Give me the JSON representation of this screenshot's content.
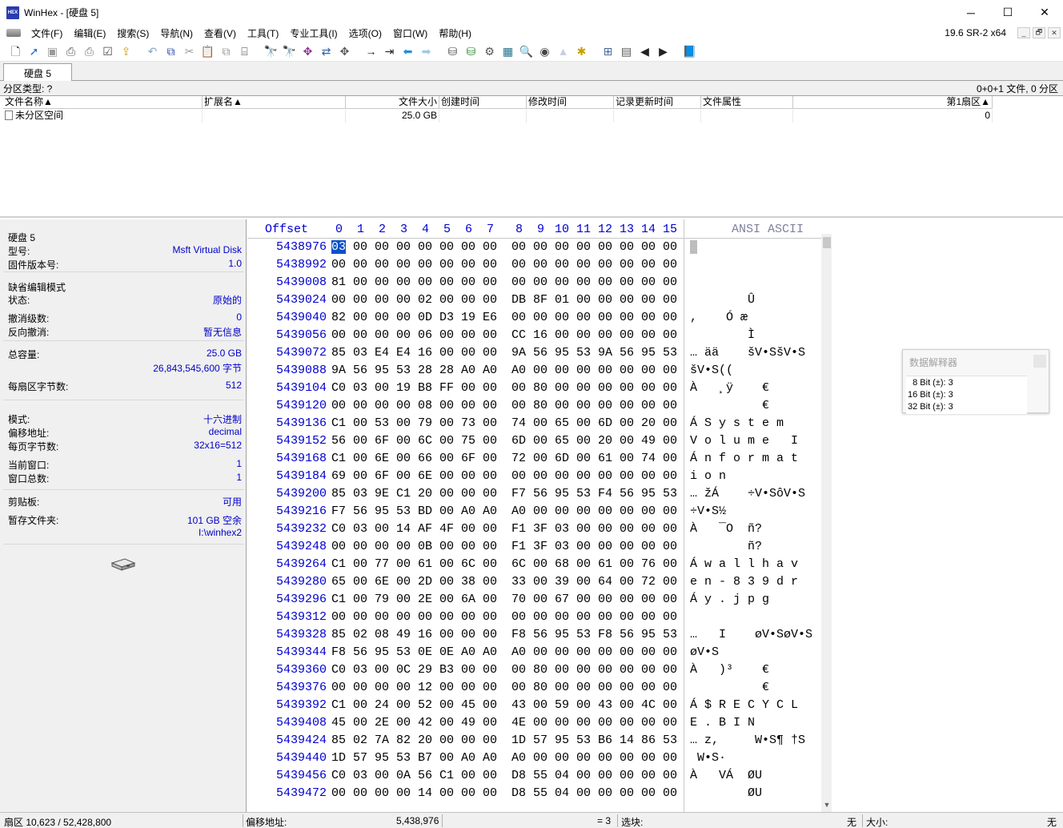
{
  "window": {
    "title": "WinHex - [硬盘 5]",
    "app_icon_text": "HEX",
    "controls": {
      "minimize": "─",
      "maximize": "☐",
      "close": "✕"
    }
  },
  "menu": {
    "items": [
      "文件(F)",
      "编辑(E)",
      "搜索(S)",
      "导航(N)",
      "查看(V)",
      "工具(T)",
      "专业工具(I)",
      "选项(O)",
      "窗口(W)",
      "帮助(H)"
    ],
    "version": "19.6 SR-2 x64",
    "mdi": {
      "minimize": "_",
      "restore": "🗗",
      "close": "✕"
    }
  },
  "toolbar": {
    "buttons": [
      {
        "name": "new-icon",
        "glyph": "🗋",
        "color": "#333333"
      },
      {
        "name": "open-icon",
        "glyph": "➚",
        "color": "#1e6fd9"
      },
      {
        "name": "save-icon",
        "glyph": "▣",
        "color": "#9a9a9a"
      },
      {
        "name": "print-icon",
        "glyph": "⎙",
        "color": "#555555"
      },
      {
        "name": "print-setup-icon",
        "glyph": "⎙",
        "color": "#777777"
      },
      {
        "name": "properties-icon",
        "glyph": "☑",
        "color": "#444444"
      },
      {
        "name": "export-icon",
        "glyph": "⇪",
        "color": "#d9a400"
      },
      {
        "name": "undo-icon",
        "glyph": "↶",
        "color": "#8aa0c8",
        "gap": true
      },
      {
        "name": "copy-icon",
        "glyph": "⧉",
        "color": "#2f4fa8"
      },
      {
        "name": "cut-icon",
        "glyph": "✂",
        "color": "#9a9a9a"
      },
      {
        "name": "paste-icon",
        "glyph": "📋",
        "color": "#555555"
      },
      {
        "name": "paste-special-icon",
        "glyph": "⧉",
        "color": "#9a9a9a"
      },
      {
        "name": "binary-icon",
        "glyph": "⌸",
        "color": "#333333"
      },
      {
        "name": "find-text-icon",
        "glyph": "🔭",
        "color": "#222222",
        "gap": true
      },
      {
        "name": "find-hex-icon",
        "glyph": "🔭",
        "color": "#aa2222"
      },
      {
        "name": "replace-text-icon",
        "glyph": "✥",
        "color": "#8a2d8a"
      },
      {
        "name": "replace-hex-icon",
        "glyph": "⇄",
        "color": "#2d5fa8"
      },
      {
        "name": "find-hex-values-icon",
        "glyph": "✥",
        "color": "#555555"
      },
      {
        "name": "goto-offset-icon",
        "glyph": "→",
        "color": "#222222",
        "gap": true
      },
      {
        "name": "goto-sector-icon",
        "glyph": "⇥",
        "color": "#222222"
      },
      {
        "name": "back-icon",
        "glyph": "⬅",
        "color": "#1e8fd9"
      },
      {
        "name": "forward-icon",
        "glyph": "➡",
        "color": "#9ac8e8"
      },
      {
        "name": "open-disk-icon",
        "glyph": "⛁",
        "color": "#555555",
        "gap": true
      },
      {
        "name": "clone-disk-icon",
        "glyph": "⛁",
        "color": "#2f8a2f"
      },
      {
        "name": "ram-editor-icon",
        "glyph": "⚙",
        "color": "#555555"
      },
      {
        "name": "calculator-icon",
        "glyph": "▦",
        "color": "#1e6f8a"
      },
      {
        "name": "hash-icon",
        "glyph": "🔍",
        "color": "#555555"
      },
      {
        "name": "checksum-icon",
        "glyph": "◉",
        "color": "#444444"
      },
      {
        "name": "case-icon",
        "glyph": "▲",
        "color": "#c8d0e0"
      },
      {
        "name": "settings-icon",
        "glyph": "✱",
        "color": "#c8a000"
      },
      {
        "name": "view-mode-icon",
        "glyph": "⊞",
        "color": "#4a6a9a",
        "gap": true
      },
      {
        "name": "layout-icon",
        "glyph": "▤",
        "color": "#555555"
      },
      {
        "name": "prev-icon",
        "glyph": "◀",
        "color": "#222222"
      },
      {
        "name": "next-icon",
        "glyph": "▶",
        "color": "#222222"
      },
      {
        "name": "help-book-icon",
        "glyph": "📘",
        "color": "#6a3d9a",
        "gap": true
      }
    ]
  },
  "tab": {
    "label": "硬盘 5"
  },
  "partition": {
    "type_label": "分区类型: ?",
    "summary": "0+0+1 文件, 0 分区"
  },
  "filelist": {
    "columns": [
      {
        "label": "文件名称▲",
        "w": 249,
        "align": "left"
      },
      {
        "label": "扩展名▲",
        "w": 179,
        "align": "left"
      },
      {
        "label": "文件大小",
        "w": 117,
        "align": "right"
      },
      {
        "label": "创建时间",
        "w": 109,
        "align": "left"
      },
      {
        "label": "修改时间",
        "w": 109,
        "align": "left"
      },
      {
        "label": "记录更新时间",
        "w": 109,
        "align": "left"
      },
      {
        "label": "文件属性",
        "w": 115,
        "align": "left"
      },
      {
        "label": "第1扇区▲",
        "w": 249,
        "align": "right"
      }
    ],
    "rows": [
      {
        "name": "未分区空间",
        "ext": "",
        "size": "25.0 GB",
        "created": "",
        "modified": "",
        "record": "",
        "attr": "",
        "first_sector": "0"
      }
    ]
  },
  "info": {
    "disk_title": "硬盘 5",
    "model_label": "型号:",
    "model_value": "Msft Virtual Disk",
    "firmware_label": "固件版本号:",
    "firmware_value": "1.0",
    "edit_mode_title": "缺省编辑模式",
    "state_label": "状态:",
    "state_value": "原始的",
    "undo_levels_label": "撤消级数:",
    "undo_levels_value": "0",
    "reverse_undo_label": "反向撤消:",
    "reverse_undo_value": "暂无信息",
    "capacity_label": "总容量:",
    "capacity_value": "25.0 GB",
    "capacity_bytes": "26,843,545,600 字节",
    "bytes_per_sector_label": "每扇区字节数:",
    "bytes_per_sector_value": "512",
    "mode_label": "模式:",
    "mode_value": "十六进制",
    "offset_label": "偏移地址:",
    "offset_value": "decimal",
    "bytes_per_page_label": "每页字节数:",
    "bytes_per_page_value": "32x16=512",
    "current_window_label": "当前窗口:",
    "current_window_value": "1",
    "total_windows_label": "窗口总数:",
    "total_windows_value": "1",
    "clipboard_label": "剪贴板:",
    "clipboard_value": "可用",
    "temp_folder_label": "暂存文件夹:",
    "temp_folder_value": "101 GB 空余",
    "temp_folder_path": "I:\\winhex2"
  },
  "hex": {
    "offset_header": "Offset",
    "column_headers": [
      "0",
      "1",
      "2",
      "3",
      "4",
      "5",
      "6",
      "7",
      "8",
      "9",
      "10",
      "11",
      "12",
      "13",
      "14",
      "15"
    ],
    "ascii_header": "ANSI ASCII",
    "rows": [
      {
        "offset": "5438976",
        "bytes": [
          "03",
          "00",
          "00",
          "00",
          "00",
          "00",
          "00",
          "00",
          "00",
          "00",
          "00",
          "00",
          "00",
          "00",
          "00",
          "00"
        ],
        "ascii": ""
      },
      {
        "offset": "5438992",
        "bytes": [
          "00",
          "00",
          "00",
          "00",
          "00",
          "00",
          "00",
          "00",
          "00",
          "00",
          "00",
          "00",
          "00",
          "00",
          "00",
          "00"
        ],
        "ascii": ""
      },
      {
        "offset": "5439008",
        "bytes": [
          "81",
          "00",
          "00",
          "00",
          "00",
          "00",
          "00",
          "00",
          "00",
          "00",
          "00",
          "00",
          "00",
          "00",
          "00",
          "00"
        ],
        "ascii": ""
      },
      {
        "offset": "5439024",
        "bytes": [
          "00",
          "00",
          "00",
          "00",
          "02",
          "00",
          "00",
          "00",
          "DB",
          "8F",
          "01",
          "00",
          "00",
          "00",
          "00",
          "00"
        ],
        "ascii": "        Û"
      },
      {
        "offset": "5439040",
        "bytes": [
          "82",
          "00",
          "00",
          "00",
          "0D",
          "D3",
          "19",
          "E6",
          "00",
          "00",
          "00",
          "00",
          "00",
          "00",
          "00",
          "00"
        ],
        "ascii": ",    Ó æ"
      },
      {
        "offset": "5439056",
        "bytes": [
          "00",
          "00",
          "00",
          "00",
          "06",
          "00",
          "00",
          "00",
          "CC",
          "16",
          "00",
          "00",
          "00",
          "00",
          "00",
          "00"
        ],
        "ascii": "        Ì"
      },
      {
        "offset": "5439072",
        "bytes": [
          "85",
          "03",
          "E4",
          "E4",
          "16",
          "00",
          "00",
          "00",
          "9A",
          "56",
          "95",
          "53",
          "9A",
          "56",
          "95",
          "53"
        ],
        "ascii": "… ää    šV•SšV•S"
      },
      {
        "offset": "5439088",
        "bytes": [
          "9A",
          "56",
          "95",
          "53",
          "28",
          "28",
          "A0",
          "A0",
          "A0",
          "00",
          "00",
          "00",
          "00",
          "00",
          "00",
          "00"
        ],
        "ascii": "šV•S(("
      },
      {
        "offset": "5439104",
        "bytes": [
          "C0",
          "03",
          "00",
          "19",
          "B8",
          "FF",
          "00",
          "00",
          "00",
          "80",
          "00",
          "00",
          "00",
          "00",
          "00",
          "00"
        ],
        "ascii": "À   ¸ÿ    €"
      },
      {
        "offset": "5439120",
        "bytes": [
          "00",
          "00",
          "00",
          "00",
          "08",
          "00",
          "00",
          "00",
          "00",
          "80",
          "00",
          "00",
          "00",
          "00",
          "00",
          "00"
        ],
        "ascii": "          €"
      },
      {
        "offset": "5439136",
        "bytes": [
          "C1",
          "00",
          "53",
          "00",
          "79",
          "00",
          "73",
          "00",
          "74",
          "00",
          "65",
          "00",
          "6D",
          "00",
          "20",
          "00"
        ],
        "ascii": "Á S y s t e m"
      },
      {
        "offset": "5439152",
        "bytes": [
          "56",
          "00",
          "6F",
          "00",
          "6C",
          "00",
          "75",
          "00",
          "6D",
          "00",
          "65",
          "00",
          "20",
          "00",
          "49",
          "00"
        ],
        "ascii": "V o l u m e   I"
      },
      {
        "offset": "5439168",
        "bytes": [
          "C1",
          "00",
          "6E",
          "00",
          "66",
          "00",
          "6F",
          "00",
          "72",
          "00",
          "6D",
          "00",
          "61",
          "00",
          "74",
          "00"
        ],
        "ascii": "Á n f o r m a t"
      },
      {
        "offset": "5439184",
        "bytes": [
          "69",
          "00",
          "6F",
          "00",
          "6E",
          "00",
          "00",
          "00",
          "00",
          "00",
          "00",
          "00",
          "00",
          "00",
          "00",
          "00"
        ],
        "ascii": "i o n"
      },
      {
        "offset": "5439200",
        "bytes": [
          "85",
          "03",
          "9E",
          "C1",
          "20",
          "00",
          "00",
          "00",
          "F7",
          "56",
          "95",
          "53",
          "F4",
          "56",
          "95",
          "53"
        ],
        "ascii": "… žÁ    ÷V•SôV•S"
      },
      {
        "offset": "5439216",
        "bytes": [
          "F7",
          "56",
          "95",
          "53",
          "BD",
          "00",
          "A0",
          "A0",
          "A0",
          "00",
          "00",
          "00",
          "00",
          "00",
          "00",
          "00"
        ],
        "ascii": "÷V•S½"
      },
      {
        "offset": "5439232",
        "bytes": [
          "C0",
          "03",
          "00",
          "14",
          "AF",
          "4F",
          "00",
          "00",
          "F1",
          "3F",
          "03",
          "00",
          "00",
          "00",
          "00",
          "00"
        ],
        "ascii": "À   ¯O  ñ?"
      },
      {
        "offset": "5439248",
        "bytes": [
          "00",
          "00",
          "00",
          "00",
          "0B",
          "00",
          "00",
          "00",
          "F1",
          "3F",
          "03",
          "00",
          "00",
          "00",
          "00",
          "00"
        ],
        "ascii": "        ñ?"
      },
      {
        "offset": "5439264",
        "bytes": [
          "C1",
          "00",
          "77",
          "00",
          "61",
          "00",
          "6C",
          "00",
          "6C",
          "00",
          "68",
          "00",
          "61",
          "00",
          "76",
          "00"
        ],
        "ascii": "Á w a l l h a v"
      },
      {
        "offset": "5439280",
        "bytes": [
          "65",
          "00",
          "6E",
          "00",
          "2D",
          "00",
          "38",
          "00",
          "33",
          "00",
          "39",
          "00",
          "64",
          "00",
          "72",
          "00"
        ],
        "ascii": "e n - 8 3 9 d r"
      },
      {
        "offset": "5439296",
        "bytes": [
          "C1",
          "00",
          "79",
          "00",
          "2E",
          "00",
          "6A",
          "00",
          "70",
          "00",
          "67",
          "00",
          "00",
          "00",
          "00",
          "00"
        ],
        "ascii": "Á y . j p g"
      },
      {
        "offset": "5439312",
        "bytes": [
          "00",
          "00",
          "00",
          "00",
          "00",
          "00",
          "00",
          "00",
          "00",
          "00",
          "00",
          "00",
          "00",
          "00",
          "00",
          "00"
        ],
        "ascii": ""
      },
      {
        "offset": "5439328",
        "bytes": [
          "85",
          "02",
          "08",
          "49",
          "16",
          "00",
          "00",
          "00",
          "F8",
          "56",
          "95",
          "53",
          "F8",
          "56",
          "95",
          "53"
        ],
        "ascii": "…   I    øV•SøV•S"
      },
      {
        "offset": "5439344",
        "bytes": [
          "F8",
          "56",
          "95",
          "53",
          "0E",
          "0E",
          "A0",
          "A0",
          "A0",
          "00",
          "00",
          "00",
          "00",
          "00",
          "00",
          "00"
        ],
        "ascii": "øV•S"
      },
      {
        "offset": "5439360",
        "bytes": [
          "C0",
          "03",
          "00",
          "0C",
          "29",
          "B3",
          "00",
          "00",
          "00",
          "80",
          "00",
          "00",
          "00",
          "00",
          "00",
          "00"
        ],
        "ascii": "À   )³    €"
      },
      {
        "offset": "5439376",
        "bytes": [
          "00",
          "00",
          "00",
          "00",
          "12",
          "00",
          "00",
          "00",
          "00",
          "80",
          "00",
          "00",
          "00",
          "00",
          "00",
          "00"
        ],
        "ascii": "          €"
      },
      {
        "offset": "5439392",
        "bytes": [
          "C1",
          "00",
          "24",
          "00",
          "52",
          "00",
          "45",
          "00",
          "43",
          "00",
          "59",
          "00",
          "43",
          "00",
          "4C",
          "00"
        ],
        "ascii": "Á $ R E C Y C L"
      },
      {
        "offset": "5439408",
        "bytes": [
          "45",
          "00",
          "2E",
          "00",
          "42",
          "00",
          "49",
          "00",
          "4E",
          "00",
          "00",
          "00",
          "00",
          "00",
          "00",
          "00"
        ],
        "ascii": "E . B I N"
      },
      {
        "offset": "5439424",
        "bytes": [
          "85",
          "02",
          "7A",
          "82",
          "20",
          "00",
          "00",
          "00",
          "1D",
          "57",
          "95",
          "53",
          "B6",
          "14",
          "86",
          "53"
        ],
        "ascii": "… z,     W•S¶ †S"
      },
      {
        "offset": "5439440",
        "bytes": [
          "1D",
          "57",
          "95",
          "53",
          "B7",
          "00",
          "A0",
          "A0",
          "A0",
          "00",
          "00",
          "00",
          "00",
          "00",
          "00",
          "00"
        ],
        "ascii": " W•S·"
      },
      {
        "offset": "5439456",
        "bytes": [
          "C0",
          "03",
          "00",
          "0A",
          "56",
          "C1",
          "00",
          "00",
          "D8",
          "55",
          "04",
          "00",
          "00",
          "00",
          "00",
          "00"
        ],
        "ascii": "À   VÁ  ØU"
      },
      {
        "offset": "5439472",
        "bytes": [
          "00",
          "00",
          "00",
          "00",
          "14",
          "00",
          "00",
          "00",
          "D8",
          "55",
          "04",
          "00",
          "00",
          "00",
          "00",
          "00"
        ],
        "ascii": "        ØU"
      }
    ]
  },
  "interpreter": {
    "title": "数据解释器",
    "rows": [
      "  8 Bit (±): 3",
      "16 Bit (±): 3",
      "32 Bit (±): 3"
    ]
  },
  "statusbar": {
    "sector": "扇区 10,623 / 52,428,800",
    "offset_label": "偏移地址:",
    "offset_value": "5,438,976",
    "value": "= 3",
    "block_label": "选块:",
    "block_value": "无",
    "size_label": "大小:",
    "size_value": "无"
  },
  "colors": {
    "offset_blue": "#0000d0",
    "info_value_blue": "#0000c8",
    "cursor_blue": "#0a50c8"
  }
}
